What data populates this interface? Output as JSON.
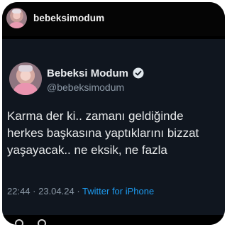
{
  "instagram": {
    "username": "bebeksimodum"
  },
  "tweet": {
    "display_name": "Bebeksi Modum",
    "handle": "@bebeksimodum",
    "text_lines": [
      "Karma der ki.. zamanı geldiğinde",
      "herkes başkasına yaptıklarını bizzat",
      "yaşayacak.. ne eksik, ne fazla"
    ],
    "time": "22:44",
    "separator": " · ",
    "date": "23.04.24",
    "source": "Twitter for iPhone",
    "verified_color": "#e1e8ed"
  }
}
